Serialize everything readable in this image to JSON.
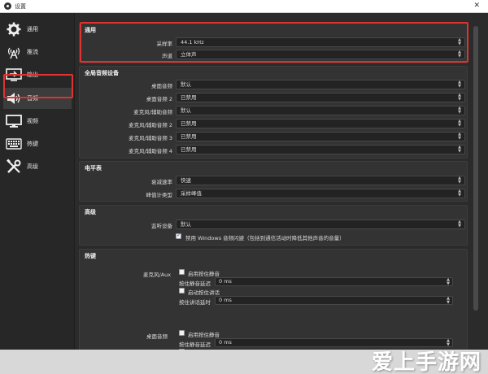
{
  "window": {
    "title": "设置",
    "close": "✕"
  },
  "sidebar": {
    "items": [
      {
        "label": "通用",
        "icon": "gear-icon"
      },
      {
        "label": "推流",
        "icon": "antenna-icon"
      },
      {
        "label": "输出",
        "icon": "output-icon"
      },
      {
        "label": "音频",
        "icon": "speaker-icon"
      },
      {
        "label": "视频",
        "icon": "monitor-icon"
      },
      {
        "label": "热键",
        "icon": "keyboard-icon"
      },
      {
        "label": "高级",
        "icon": "tools-icon"
      }
    ],
    "active_index": 3
  },
  "general": {
    "title": "通用",
    "sample_rate_label": "采样率",
    "sample_rate_value": "44.1 kHz",
    "channels_label": "声道",
    "channels_value": "立体声"
  },
  "global_devices": {
    "title": "全局音频设备",
    "rows": [
      {
        "label": "桌面音频",
        "value": "默认"
      },
      {
        "label": "桌面音频 2",
        "value": "已禁用"
      },
      {
        "label": "麦克风/辅助音频",
        "value": "默认"
      },
      {
        "label": "麦克风/辅助音频 2",
        "value": "已禁用"
      },
      {
        "label": "麦克风/辅助音频 3",
        "value": "已禁用"
      },
      {
        "label": "麦克风/辅助音频 4",
        "value": "已禁用"
      }
    ]
  },
  "meters": {
    "title": "电平表",
    "decay_label": "衰减速率",
    "decay_value": "快速",
    "peak_label": "峰值计类型",
    "peak_value": "采样峰值"
  },
  "advanced": {
    "title": "高级",
    "monitor_label": "监听设备",
    "monitor_value": "默认",
    "ducking_label": "禁用 Windows 音频闪避（包括到通信活动时降低其他声音的音量）"
  },
  "hotkeys": {
    "title": "热键",
    "mic_label": "麦克风/Aux",
    "desktop_label": "桌面音频",
    "ptm_enable": "启用按住静音",
    "ptm_delay": "按住静音延迟",
    "ptt_enable": "启动按住讲话",
    "ptt_delay": "按住讲话延时",
    "ptm_delay_label_2": "按住静音延迟",
    "delay_value": "0  ms"
  },
  "watermark": "爱上手游网",
  "colors": {
    "highlight": "#e0322f",
    "bg": "#2b2b2b",
    "panel": "#333333"
  }
}
